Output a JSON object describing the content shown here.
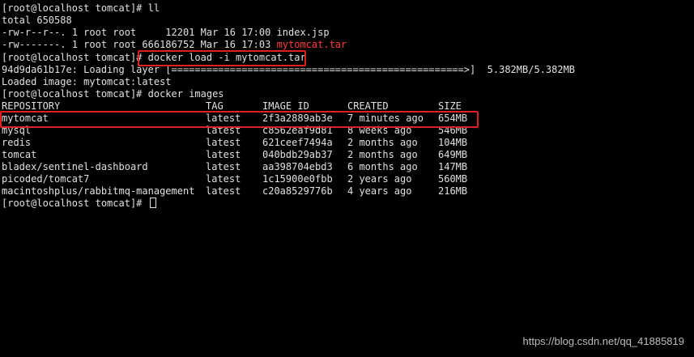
{
  "terminal": {
    "lines": {
      "l0": "[root@localhost tomcat]# ll",
      "l1": "total 650588",
      "l2_pre": "-rw-r--r--. 1 root root     12201 Mar 16 17:00 ",
      "l2_file": "index.jsp",
      "l3_pre": "-rw-------. 1 root root 666186752 Mar 16 17:03 ",
      "l3_file": "mytomcat.tar",
      "l4_prompt": "[root@localhost tomcat]# ",
      "l4_cmd": "docker load -i mytomcat.tar",
      "l5": "94d9da61b17e: Loading layer [==================================================>]  5.382MB/5.382MB",
      "l6": "Loaded image: mytomcat:latest",
      "l7": "[root@localhost tomcat]# docker images",
      "final_prompt": "[root@localhost tomcat]# "
    },
    "table": {
      "headers": [
        "REPOSITORY",
        "TAG",
        "IMAGE ID",
        "CREATED",
        "SIZE"
      ],
      "rows": [
        [
          "mytomcat",
          "latest",
          "2f3a2889ab3e",
          "7 minutes ago",
          "654MB"
        ],
        [
          "mysql",
          "latest",
          "c8562eaf9d81",
          "8 weeks ago",
          "546MB"
        ],
        [
          "redis",
          "latest",
          "621ceef7494a",
          "2 months ago",
          "104MB"
        ],
        [
          "tomcat",
          "latest",
          "040bdb29ab37",
          "2 months ago",
          "649MB"
        ],
        [
          "bladex/sentinel-dashboard",
          "latest",
          "aa398704ebd3",
          "6 months ago",
          "147MB"
        ],
        [
          "picoded/tomcat7",
          "latest",
          "1c15900e0fbb",
          "2 years ago",
          "560MB"
        ],
        [
          "macintoshplus/rabbitmq-management",
          "latest",
          "c20a8529776b",
          "4 years ago",
          "216MB"
        ]
      ]
    }
  },
  "watermark": "https://blog.csdn.net/qq_41885819",
  "colors": {
    "background": "#000000",
    "text": "#e0e0e0",
    "highlight": "#ff3b3b",
    "annotation_box": "#e02020"
  }
}
